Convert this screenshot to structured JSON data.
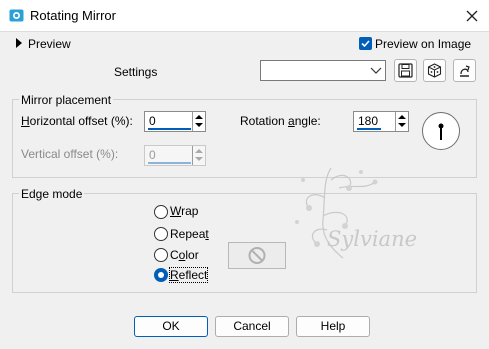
{
  "window": {
    "title": "Rotating Mirror",
    "close_icon": "close-icon",
    "app_icon": "paint-shop-pro-icon"
  },
  "preview": {
    "label": "Preview",
    "on_image_label": "Preview on Image",
    "on_image_checked": true
  },
  "settings": {
    "label": "Settings",
    "value": "",
    "buttons": [
      "save-preset-icon",
      "randomize-icon",
      "reset-icon"
    ]
  },
  "mirror_placement": {
    "title": "Mirror placement",
    "horizontal_offset": {
      "label_pre": "",
      "label_u": "H",
      "label_post": "orizontal offset (%):",
      "value": "0"
    },
    "vertical_offset": {
      "label": "Vertical offset (%):",
      "value": "0",
      "disabled": true
    },
    "rotation_angle": {
      "label_pre": "Rotation ",
      "label_u": "a",
      "label_post": "ngle:",
      "value": "180"
    }
  },
  "edge_mode": {
    "title": "Edge mode",
    "options": [
      {
        "pre": "",
        "u": "W",
        "post": "rap",
        "checked": false
      },
      {
        "pre": "Repea",
        "u": "t",
        "post": "",
        "checked": false
      },
      {
        "pre": "C",
        "u": "o",
        "post": "lor",
        "checked": false
      },
      {
        "pre": "",
        "u": "R",
        "post": "eflect",
        "checked": true
      }
    ],
    "color_swatch_icon": "no-color-icon"
  },
  "watermark": {
    "text": "Sylviane"
  },
  "footer": {
    "ok": "OK",
    "cancel": "Cancel",
    "help": "Help"
  },
  "colors": {
    "accent": "#005fb8",
    "background": "#f0f0f0"
  }
}
